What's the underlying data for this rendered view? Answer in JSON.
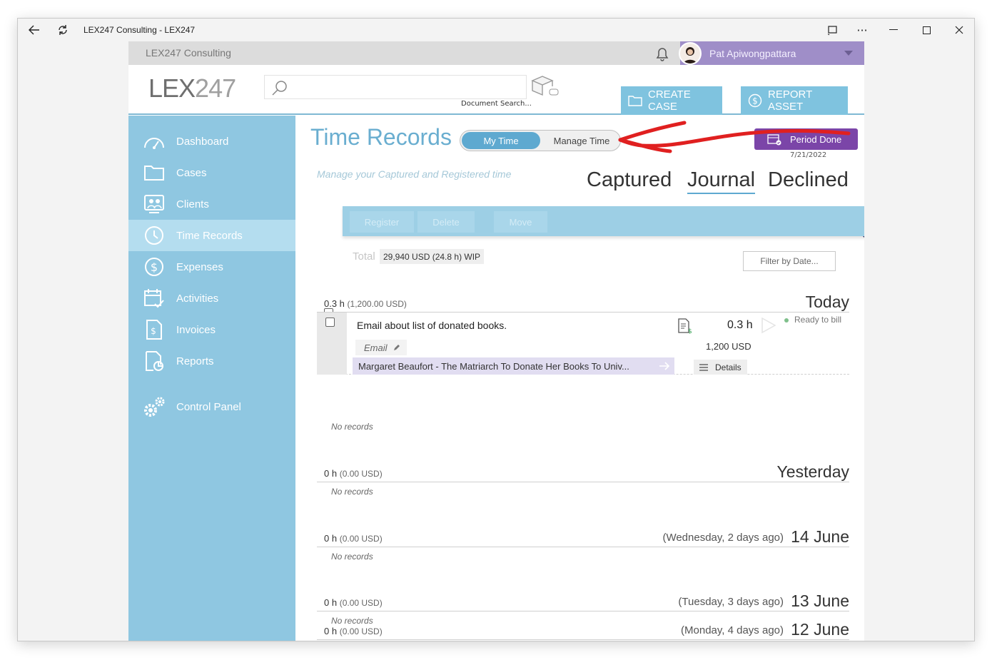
{
  "window": {
    "title": "LEX247 Consulting - LEX247"
  },
  "topbar": {
    "company": "LEX247 Consulting",
    "user_name": "Pat Apiwongpattara"
  },
  "header": {
    "logo_bold": "LEX",
    "logo_thin": "247",
    "search_caption": "Document Search...",
    "create_case_label": "CREATE CASE",
    "report_asset_label": "REPORT ASSET"
  },
  "sidebar": {
    "items": [
      {
        "label": "Dashboard",
        "icon": "gauge-icon"
      },
      {
        "label": "Cases",
        "icon": "folder-icon"
      },
      {
        "label": "Clients",
        "icon": "clients-icon"
      },
      {
        "label": "Time Records",
        "icon": "clock-icon",
        "active": true
      },
      {
        "label": "Expenses",
        "icon": "dollar-icon"
      },
      {
        "label": "Activities",
        "icon": "calendar-check-icon"
      },
      {
        "label": "Invoices",
        "icon": "invoice-icon"
      },
      {
        "label": "Reports",
        "icon": "report-icon"
      },
      {
        "label": "Control Panel",
        "icon": "gears-icon"
      }
    ]
  },
  "main": {
    "title": "Time Records",
    "toggle": {
      "my_time": "My Time",
      "manage_time": "Manage Time"
    },
    "period_done": {
      "label": "Period Done",
      "date": "7/21/2022"
    },
    "subtitle": "Manage your Captured and Registered time",
    "view_tabs": [
      {
        "label": "Captured"
      },
      {
        "label": "Journal",
        "active": true
      },
      {
        "label": "Declined"
      }
    ],
    "actions": {
      "register": "Register",
      "delete": "Delete",
      "move": "Move"
    },
    "total": {
      "label": "Total",
      "value": "29,940 USD (24.8 h)  WIP"
    },
    "filter_label": "Filter by Date...",
    "no_records": "No records",
    "groups": [
      {
        "hours": "0.3 h",
        "usd": "(1,200.00 USD)",
        "relative": "",
        "day": "Today"
      },
      {
        "hours": "0 h",
        "usd": "(0.00 USD)",
        "relative": "",
        "day": "Yesterday"
      },
      {
        "hours": "0 h",
        "usd": "(0.00 USD)",
        "relative": "(Wednesday, 2 days ago)",
        "day": "14 June"
      },
      {
        "hours": "0 h",
        "usd": "(0.00 USD)",
        "relative": "(Tuesday, 3 days ago)",
        "day": "13 June"
      },
      {
        "hours": "0 h",
        "usd": "(0.00 USD)",
        "relative": "(Monday, 4 days ago)",
        "day": "12 June"
      }
    ],
    "record": {
      "description": "Email about list of donated books.",
      "type": "Email",
      "case": "Margaret Beaufort - The Matriarch To Donate Her Books To Univ...",
      "hours": "0.3 h",
      "amount": "1,200 USD",
      "status": "Ready to bill",
      "details_label": "Details"
    }
  },
  "colors": {
    "accent": "#5ea9d0",
    "sidebar": "#8fc7e1",
    "sidebar_active": "#b4ddef",
    "user_bar": "#9f8ec8",
    "period_done": "#7b45a8",
    "annotation_arrow": "#e02020"
  }
}
